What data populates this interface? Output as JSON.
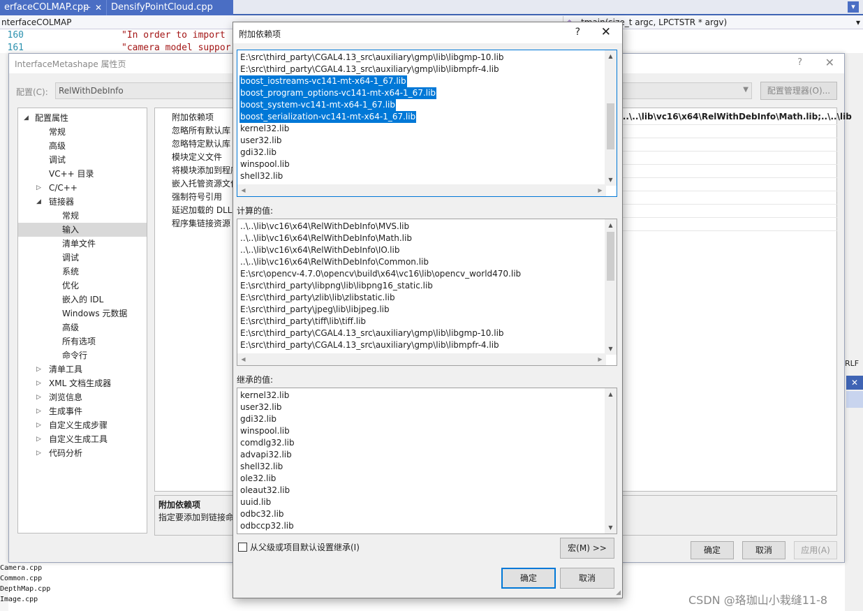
{
  "editor": {
    "tabs": [
      {
        "label": "erfaceCOLMAP.cpp",
        "pin": "⊹",
        "close": "✕"
      },
      {
        "label": "DensifyPointCloud.cpp"
      }
    ],
    "nav": {
      "project": "nterfaceCOLMAP",
      "function": "_tmain(size_t argc, LPCTSTR * argv)"
    },
    "code": [
      {
        "num": "160",
        "text": "\"In order to import"
      },
      {
        "num": "161",
        "text": "\"camera model suppor"
      }
    ],
    "output_lines": [
      "Camera.cpp",
      "Common.cpp",
      "DepthMap.cpp",
      "Image.cpp"
    ],
    "status_right": "RLF",
    "watermark": "CSDN @珞珈山小栽缝11-8"
  },
  "property_dialog": {
    "title": "InterfaceMetashape 属性页",
    "help": "?",
    "close": "✕",
    "config_label": "配置(C):",
    "config_value": "RelWithDebInfo",
    "config_manager": "配置管理器(O)...",
    "tree": [
      {
        "label": "配置属性",
        "level": 0,
        "arrow": "◢"
      },
      {
        "label": "常规",
        "level": 1
      },
      {
        "label": "高级",
        "level": 1
      },
      {
        "label": "调试",
        "level": 1
      },
      {
        "label": "VC++ 目录",
        "level": 1
      },
      {
        "label": "C/C++",
        "level": 1,
        "arrow": "▷"
      },
      {
        "label": "链接器",
        "level": 1,
        "arrow": "◢"
      },
      {
        "label": "常规",
        "level": 2
      },
      {
        "label": "输入",
        "level": 2,
        "selected": true
      },
      {
        "label": "清单文件",
        "level": 2
      },
      {
        "label": "调试",
        "level": 2
      },
      {
        "label": "系统",
        "level": 2
      },
      {
        "label": "优化",
        "level": 2
      },
      {
        "label": "嵌入的 IDL",
        "level": 2
      },
      {
        "label": "Windows 元数据",
        "level": 2
      },
      {
        "label": "高级",
        "level": 2
      },
      {
        "label": "所有选项",
        "level": 2
      },
      {
        "label": "命令行",
        "level": 2
      },
      {
        "label": "清单工具",
        "level": 1,
        "arrow": "▷"
      },
      {
        "label": "XML 文档生成器",
        "level": 1,
        "arrow": "▷"
      },
      {
        "label": "浏览信息",
        "level": 1,
        "arrow": "▷"
      },
      {
        "label": "生成事件",
        "level": 1,
        "arrow": "▷"
      },
      {
        "label": "自定义生成步骤",
        "level": 1,
        "arrow": "▷"
      },
      {
        "label": "自定义生成工具",
        "level": 1,
        "arrow": "▷"
      },
      {
        "label": "代码分析",
        "level": 1,
        "arrow": "▷"
      }
    ],
    "grid_labels": [
      "附加依赖项",
      "忽略所有默认库",
      "忽略特定默认库",
      "模块定义文件",
      "将模块添加到程序集",
      "嵌入托管资源文件",
      "强制符号引用",
      "延迟加载的 DLL",
      "程序集链接资源"
    ],
    "grid_value": ":..\\..\\lib\\vc16\\x64\\RelWithDebInfo\\Math.lib;..\\..\\lib",
    "desc_title": "附加依赖项",
    "desc_text": "指定要添加到链接命令",
    "ok": "确定",
    "cancel": "取消",
    "apply": "应用(A)"
  },
  "modal": {
    "title": "附加依赖项",
    "help": "?",
    "close": "✕",
    "edit_lines": [
      "E:\\src\\third_party\\CGAL4.13_src\\auxiliary\\gmp\\lib\\libgmp-10.lib",
      "E:\\src\\third_party\\CGAL4.13_src\\auxiliary\\gmp\\lib\\libmpfr-4.lib",
      "boost_iostreams-vc141-mt-x64-1_67.lib",
      "boost_program_options-vc141-mt-x64-1_67.lib",
      "boost_system-vc141-mt-x64-1_67.lib",
      "boost_serialization-vc141-mt-x64-1_67.lib",
      "kernel32.lib",
      "user32.lib",
      "gdi32.lib",
      "winspool.lib",
      "shell32.lib"
    ],
    "highlighted": [
      2,
      3,
      4,
      5
    ],
    "computed_label": "计算的值:",
    "computed_lines": [
      "..\\..\\lib\\vc16\\x64\\RelWithDebInfo\\MVS.lib",
      "..\\..\\lib\\vc16\\x64\\RelWithDebInfo\\Math.lib",
      "..\\..\\lib\\vc16\\x64\\RelWithDebInfo\\IO.lib",
      "..\\..\\lib\\vc16\\x64\\RelWithDebInfo\\Common.lib",
      "E:\\src\\opencv-4.7.0\\opencv\\build\\x64\\vc16\\lib\\opencv_world470.lib",
      "E:\\src\\third_party\\libpng\\lib\\libpng16_static.lib",
      "E:\\src\\third_party\\zlib\\lib\\zlibstatic.lib",
      "E:\\src\\third_party\\jpeg\\lib\\libjpeg.lib",
      "E:\\src\\third_party\\tiff\\lib\\tiff.lib",
      "E:\\src\\third_party\\CGAL4.13_src\\auxiliary\\gmp\\lib\\libgmp-10.lib",
      "E:\\src\\third_party\\CGAL4.13_src\\auxiliary\\gmp\\lib\\libmpfr-4.lib"
    ],
    "inherited_label": "继承的值:",
    "inherited_lines": [
      "kernel32.lib",
      "user32.lib",
      "gdi32.lib",
      "winspool.lib",
      "comdlg32.lib",
      "advapi32.lib",
      "shell32.lib",
      "ole32.lib",
      "oleaut32.lib",
      "uuid.lib",
      "odbc32.lib",
      "odbccp32.lib"
    ],
    "inherit_checkbox_label": "从父级或项目默认设置继承(I)",
    "macro_button": "宏(M) >>",
    "ok": "确定",
    "cancel": "取消"
  }
}
